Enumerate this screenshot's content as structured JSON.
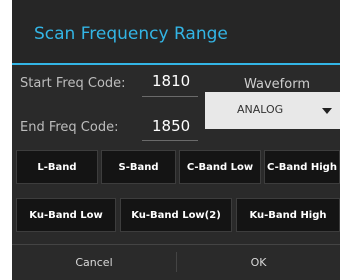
{
  "dialog": {
    "title": "Scan Frequency Range"
  },
  "start": {
    "label": "Start Freq Code:",
    "value": "1810"
  },
  "end": {
    "label": "End Freq Code:",
    "value": "1850"
  },
  "waveform": {
    "label": "Waveform",
    "selected": "ANALOG"
  },
  "bands": {
    "row1": [
      "L-Band",
      "S-Band",
      "C-Band Low",
      "C-Band High"
    ],
    "row2": [
      "Ku-Band Low",
      "Ku-Band Low(2)",
      "Ku-Band High"
    ]
  },
  "footer": {
    "cancel": "Cancel",
    "ok": "OK"
  },
  "colors": {
    "accent": "#33b5e5",
    "dialog_bg": "#2a2a2a",
    "button_bg": "#141414"
  }
}
